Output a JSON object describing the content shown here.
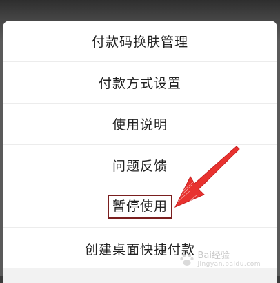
{
  "menu": {
    "items": [
      {
        "label": "付款码换肤管理"
      },
      {
        "label": "付款方式设置"
      },
      {
        "label": "使用说明"
      },
      {
        "label": "问题反馈"
      },
      {
        "label": "暂停使用"
      },
      {
        "label": "创建桌面快捷付款"
      }
    ]
  },
  "annotation": {
    "highlight_color": "#7a1f1f",
    "arrow_color": "#e8322f",
    "arrow_icon": "red-arrow-icon"
  },
  "watermark": {
    "brand": "Bai经验",
    "url": "jingyan.baidu.com"
  }
}
